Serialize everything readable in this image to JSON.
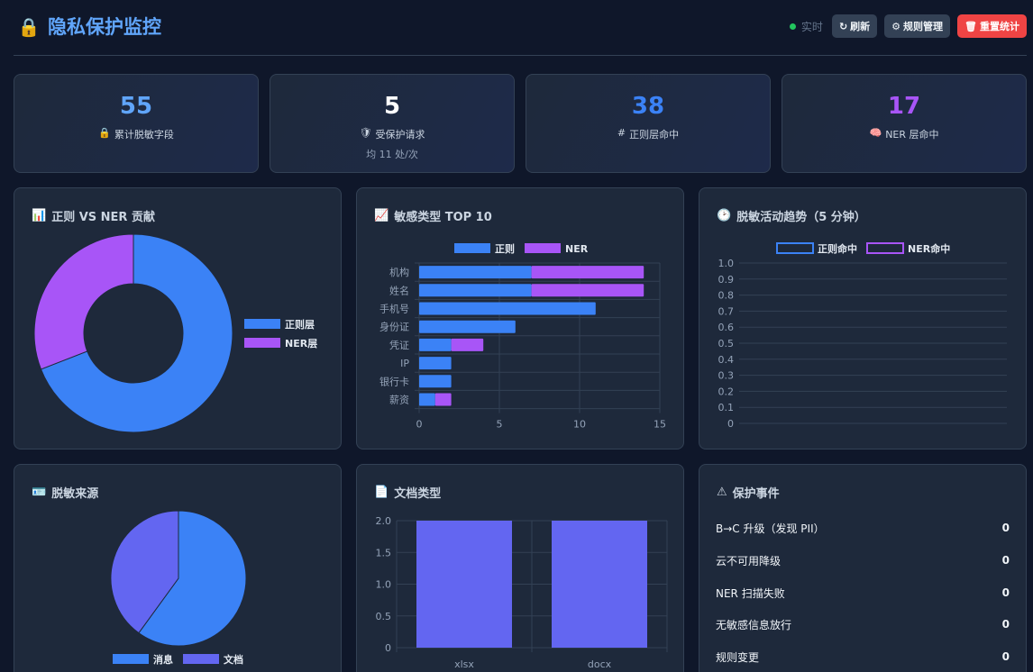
{
  "header": {
    "title": "隐私保护监控",
    "live_label": "实时",
    "refresh_label": "刷新",
    "rules_label": "规则管理",
    "reset_label": "重置统计"
  },
  "stats": [
    {
      "value": "55",
      "icon": "🔒",
      "label": "累计脱敏字段",
      "sub": "",
      "color": "#60a5fa"
    },
    {
      "value": "5",
      "icon": "🛡",
      "label": "受保护请求",
      "sub": "均 11 处/次",
      "color": "#ffffff"
    },
    {
      "value": "38",
      "icon": "#",
      "label": "正则层命中",
      "sub": "",
      "color": "#3b82f6"
    },
    {
      "value": "17",
      "icon": "🧠",
      "label": "NER 层命中",
      "sub": "",
      "color": "#a855f7"
    }
  ],
  "panels": {
    "contrib": {
      "icon": "📊",
      "title": "正则 VS NER 贡献"
    },
    "top10": {
      "icon": "📈",
      "title": "敏感类型 TOP 10"
    },
    "trend": {
      "icon": "🕑",
      "title": "脱敏活动趋势（5 分钟）"
    },
    "sources": {
      "icon": "🪪",
      "title": "脱敏来源"
    },
    "doctypes": {
      "icon": "📄",
      "title": "文档类型"
    },
    "events": {
      "icon": "⚠",
      "title": "保护事件"
    }
  },
  "colors": {
    "regex": "#3b82f6",
    "ner": "#a855f7",
    "doc": "#6366f1"
  },
  "chart_data": [
    {
      "type": "pie",
      "id": "contrib",
      "labels": [
        "正则层",
        "NER层"
      ],
      "values": [
        38,
        17
      ]
    },
    {
      "type": "bar",
      "id": "top10",
      "orientation": "horizontal",
      "stacked": true,
      "categories": [
        "机构",
        "姓名",
        "手机号",
        "身份证",
        "凭证",
        "IP",
        "银行卡",
        "薪资"
      ],
      "series": [
        {
          "name": "正则",
          "values": [
            7,
            7,
            11,
            6,
            2,
            2,
            2,
            1
          ]
        },
        {
          "name": "NER",
          "values": [
            7,
            7,
            0,
            0,
            2,
            0,
            0,
            1
          ]
        }
      ],
      "xticks": [
        "0",
        "5",
        "10",
        "15"
      ],
      "xlim": [
        0,
        15
      ],
      "legend": "top"
    },
    {
      "type": "line",
      "id": "trend",
      "series": [
        {
          "name": "正则命中",
          "values": []
        },
        {
          "name": "NER命中",
          "values": []
        }
      ],
      "yticks": [
        "1.0",
        "0.9",
        "0.8",
        "0.7",
        "0.6",
        "0.5",
        "0.4",
        "0.3",
        "0.2",
        "0.1",
        "0"
      ],
      "ylim": [
        0,
        1
      ],
      "legend": "top"
    },
    {
      "type": "pie",
      "id": "sources",
      "labels": [
        "消息",
        "文档"
      ],
      "values": [
        60,
        40
      ],
      "legend": "bottom"
    },
    {
      "type": "bar",
      "id": "doctypes",
      "categories": [
        "xlsx",
        "docx"
      ],
      "values": [
        2,
        2
      ],
      "yticks": [
        "2.0",
        "1.5",
        "1.0",
        "0.5",
        "0"
      ],
      "ylim": [
        0,
        2
      ]
    }
  ],
  "events": [
    {
      "label": "B→C 升级（发现 PII）",
      "value": "0"
    },
    {
      "label": "云不可用降级",
      "value": "0"
    },
    {
      "label": "NER 扫描失败",
      "value": "0"
    },
    {
      "label": "无敏感信息放行",
      "value": "0"
    },
    {
      "label": "规则变更",
      "value": "0"
    }
  ]
}
